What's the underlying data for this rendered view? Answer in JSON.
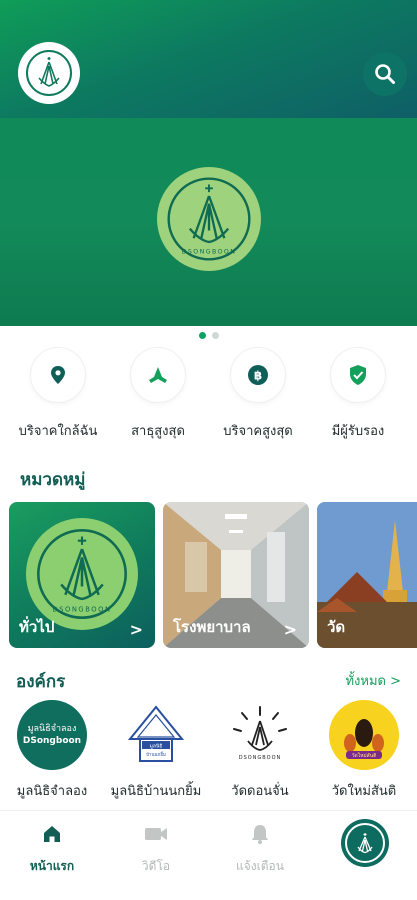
{
  "header": {
    "logo_icon": "dsongboon-logo-icon",
    "search_icon": "search-icon"
  },
  "banner": {
    "logo_text": "DSONGBOON",
    "dots_total": 2,
    "active_dot": 1
  },
  "quick_actions": [
    {
      "label": "บริจาคใกล้ฉัน",
      "icon": "location-pin-icon"
    },
    {
      "label": "สาธุสูงสุด",
      "icon": "praying-hands-icon"
    },
    {
      "label": "บริจาคสูงสุด",
      "icon": "baht-coin-icon"
    },
    {
      "label": "มีผู้รับรอง",
      "icon": "shield-check-icon"
    }
  ],
  "categories": {
    "title": "หมวดหมู่",
    "items": [
      {
        "label": "ทั่วไป"
      },
      {
        "label": "โรงพยาบาล"
      },
      {
        "label": "วัด"
      }
    ],
    "chevron": ">"
  },
  "organizations": {
    "title": "องค์กร",
    "see_all": "ทั้งหมด  >",
    "items": [
      {
        "name": "มูลนิธิจำลอง",
        "logo_line1": "มูลนิธิจำลอง",
        "logo_line2": "DSongboon"
      },
      {
        "name": "มูลนิธิบ้านนกยิ้ม",
        "logo_line1": "มูลนิธิ",
        "logo_line2": "บ้านนกยิ้ม"
      },
      {
        "name": "วัดดอนจั่น",
        "logo_text": "DSONGBOON"
      },
      {
        "name": "วัดใหม่สันติ",
        "logo_text": "วัดใหม่สันติ"
      }
    ]
  },
  "bottom_nav": [
    {
      "label": "หน้าแรก",
      "icon": "home-icon",
      "active": true
    },
    {
      "label": "วิดีโอ",
      "icon": "video-camera-icon",
      "active": false
    },
    {
      "label": "แจ้งเตือน",
      "icon": "bell-icon",
      "active": false
    },
    {
      "label": "",
      "icon": "profile-avatar-icon",
      "active": false
    }
  ],
  "colors": {
    "brand_green": "#13a05a",
    "brand_dark": "#125e55",
    "logo_light_green": "#9ed27c"
  }
}
